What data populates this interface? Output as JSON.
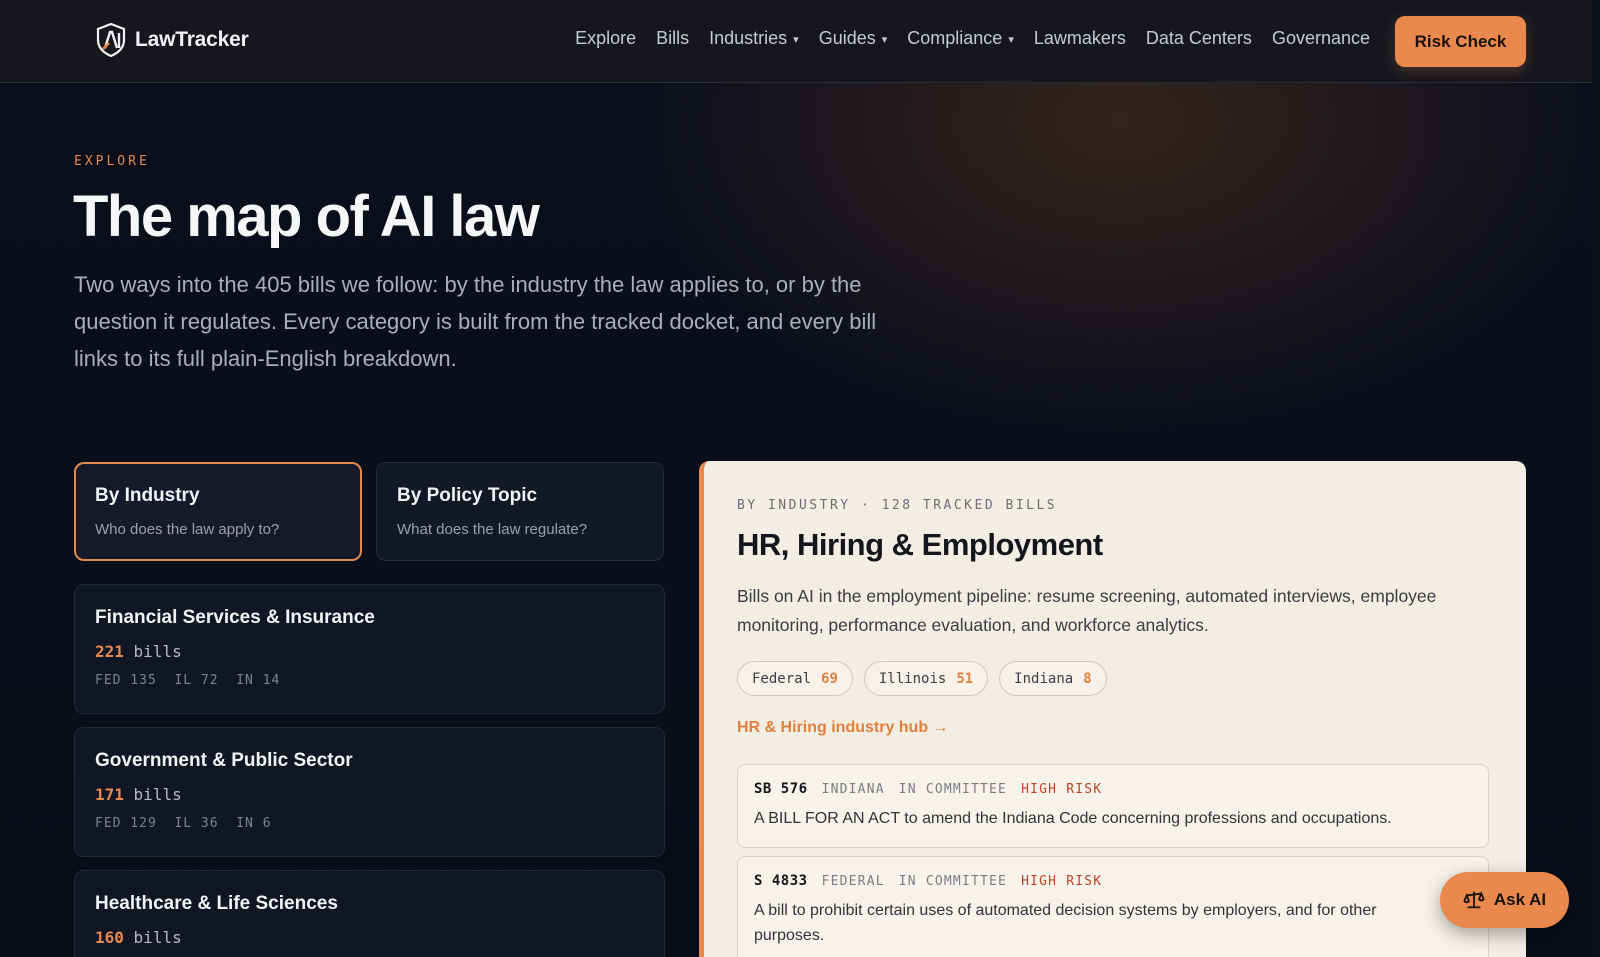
{
  "nav": {
    "brand": "LawTracker",
    "links": [
      {
        "label": "Explore",
        "dropdown": false
      },
      {
        "label": "Bills",
        "dropdown": false
      },
      {
        "label": "Industries",
        "dropdown": true
      },
      {
        "label": "Guides",
        "dropdown": true
      },
      {
        "label": "Compliance",
        "dropdown": true
      },
      {
        "label": "Lawmakers",
        "dropdown": false
      },
      {
        "label": "Data Centers",
        "dropdown": false
      },
      {
        "label": "Governance",
        "dropdown": false
      }
    ],
    "cta": "Risk Check"
  },
  "hero": {
    "eyebrow": "EXPLORE",
    "title": "The map of AI law",
    "lead": "Two ways into the 405 bills we follow: by the industry the law applies to, or by the question it regulates. Every category is built from the tracked docket, and every bill links to its full plain-English breakdown."
  },
  "toggles": [
    {
      "title": "By Industry",
      "subtitle": "Who does the law apply to?",
      "active": true
    },
    {
      "title": "By Policy Topic",
      "subtitle": "What does the law regulate?",
      "active": false
    }
  ],
  "industries": [
    {
      "title": "Financial Services & Insurance",
      "count": "221",
      "unit": "bills",
      "breakdown": "FED 135  IL 72  IN 14"
    },
    {
      "title": "Government & Public Sector",
      "count": "171",
      "unit": "bills",
      "breakdown": "FED 129  IL 36  IN 6"
    },
    {
      "title": "Healthcare & Life Sciences",
      "count": "160",
      "unit": "bills",
      "breakdown": ""
    }
  ],
  "panel": {
    "eyebrow": "BY INDUSTRY · 128 TRACKED BILLS",
    "title": "HR, Hiring & Employment",
    "description": "Bills on AI in the employment pipeline: resume screening, automated interviews, employee monitoring, performance evaluation, and workforce analytics.",
    "chips": [
      {
        "label": "Federal",
        "count": "69"
      },
      {
        "label": "Illinois",
        "count": "51"
      },
      {
        "label": "Indiana",
        "count": "8"
      }
    ],
    "hub_link": "HR & Hiring industry hub →",
    "bills": [
      {
        "id": "SB 576",
        "jurisdiction": "INDIANA",
        "status": "IN COMMITTEE",
        "risk": "HIGH RISK",
        "text": "A BILL FOR AN ACT to amend the Indiana Code concerning professions and occupations."
      },
      {
        "id": "S 4833",
        "jurisdiction": "FEDERAL",
        "status": "IN COMMITTEE",
        "risk": "HIGH RISK",
        "text": "A bill to prohibit certain uses of automated decision systems by employers, and for other purposes."
      }
    ]
  },
  "ask_ai": "Ask AI",
  "colors": {
    "accent": "#e9894e",
    "risk": "#c0442a",
    "panel_bg": "#f3eee3"
  }
}
